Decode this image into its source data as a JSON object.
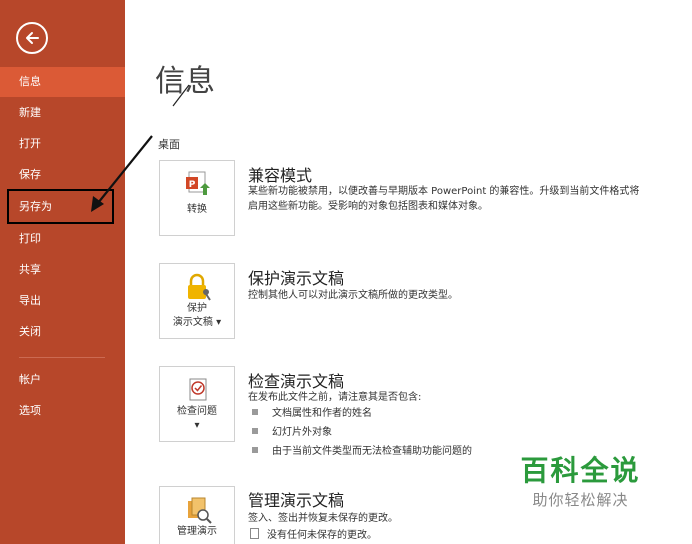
{
  "sidebar": {
    "items": [
      {
        "label": "信息"
      },
      {
        "label": "新建"
      },
      {
        "label": "打开"
      },
      {
        "label": "保存"
      },
      {
        "label": "另存为"
      },
      {
        "label": "打印"
      },
      {
        "label": "共享"
      },
      {
        "label": "导出"
      },
      {
        "label": "关闭"
      },
      {
        "label": "帐户"
      },
      {
        "label": "选项"
      }
    ],
    "active_index": 0
  },
  "main": {
    "title": "信息",
    "location": "桌面",
    "sections": [
      {
        "tile_label": "转换",
        "title": "兼容模式",
        "desc1": "某些新功能被禁用，以便改善与早期版本 PowerPoint 的兼容性。升级到当前文件格式将",
        "desc2": "启用这些新功能。受影响的对象包括图表和媒体对象。"
      },
      {
        "tile_label1": "保护",
        "tile_label2": "演示文稿 ▾",
        "title": "保护演示文稿",
        "desc1": "控制其他人可以对此演示文稿所做的更改类型。"
      },
      {
        "tile_label": "检查问题",
        "tile_caret": "▾",
        "title": "检查演示文稿",
        "desc1": "在发布此文件之前，请注意其是否包含:",
        "bullets": [
          "文档属性和作者的姓名",
          "幻灯片外对象",
          "由于当前文件类型而无法检查辅助功能问题的"
        ]
      },
      {
        "tile_label": "管理演示",
        "title": "管理演示文稿",
        "desc1": "签入、签出并恢复未保存的更改。",
        "desc2": "没有任何未保存的更改。"
      }
    ]
  },
  "watermark": {
    "main": "百科全说",
    "sub": "助你轻松解决"
  },
  "colors": {
    "sidebar": "#b7472a",
    "sidebar_active": "#db5a36",
    "watermark_green": "#2b9a3c"
  }
}
